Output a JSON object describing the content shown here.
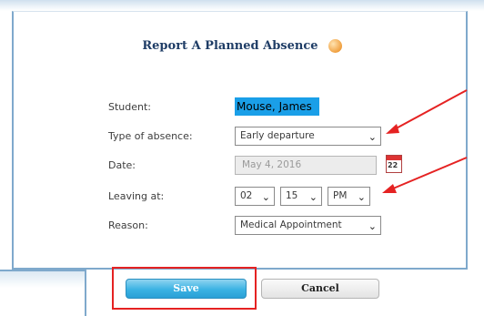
{
  "dialog": {
    "title": "Report A Planned Absence",
    "help_icon": "help-icon"
  },
  "form": {
    "student_label": "Student:",
    "student_value": "Mouse, James",
    "type_label": "Type of absence:",
    "type_value": "Early departure",
    "date_label": "Date:",
    "date_value": "May 4, 2016",
    "calendar_day": "22",
    "leaving_label": "Leaving at:",
    "hour_value": "02",
    "minute_value": "15",
    "ampm_value": "PM",
    "reason_label": "Reason:",
    "reason_value": "Medical Appointment"
  },
  "buttons": {
    "save": "Save",
    "cancel": "Cancel"
  },
  "annotations": {
    "color": "#e52222",
    "arrow_count": 2
  }
}
